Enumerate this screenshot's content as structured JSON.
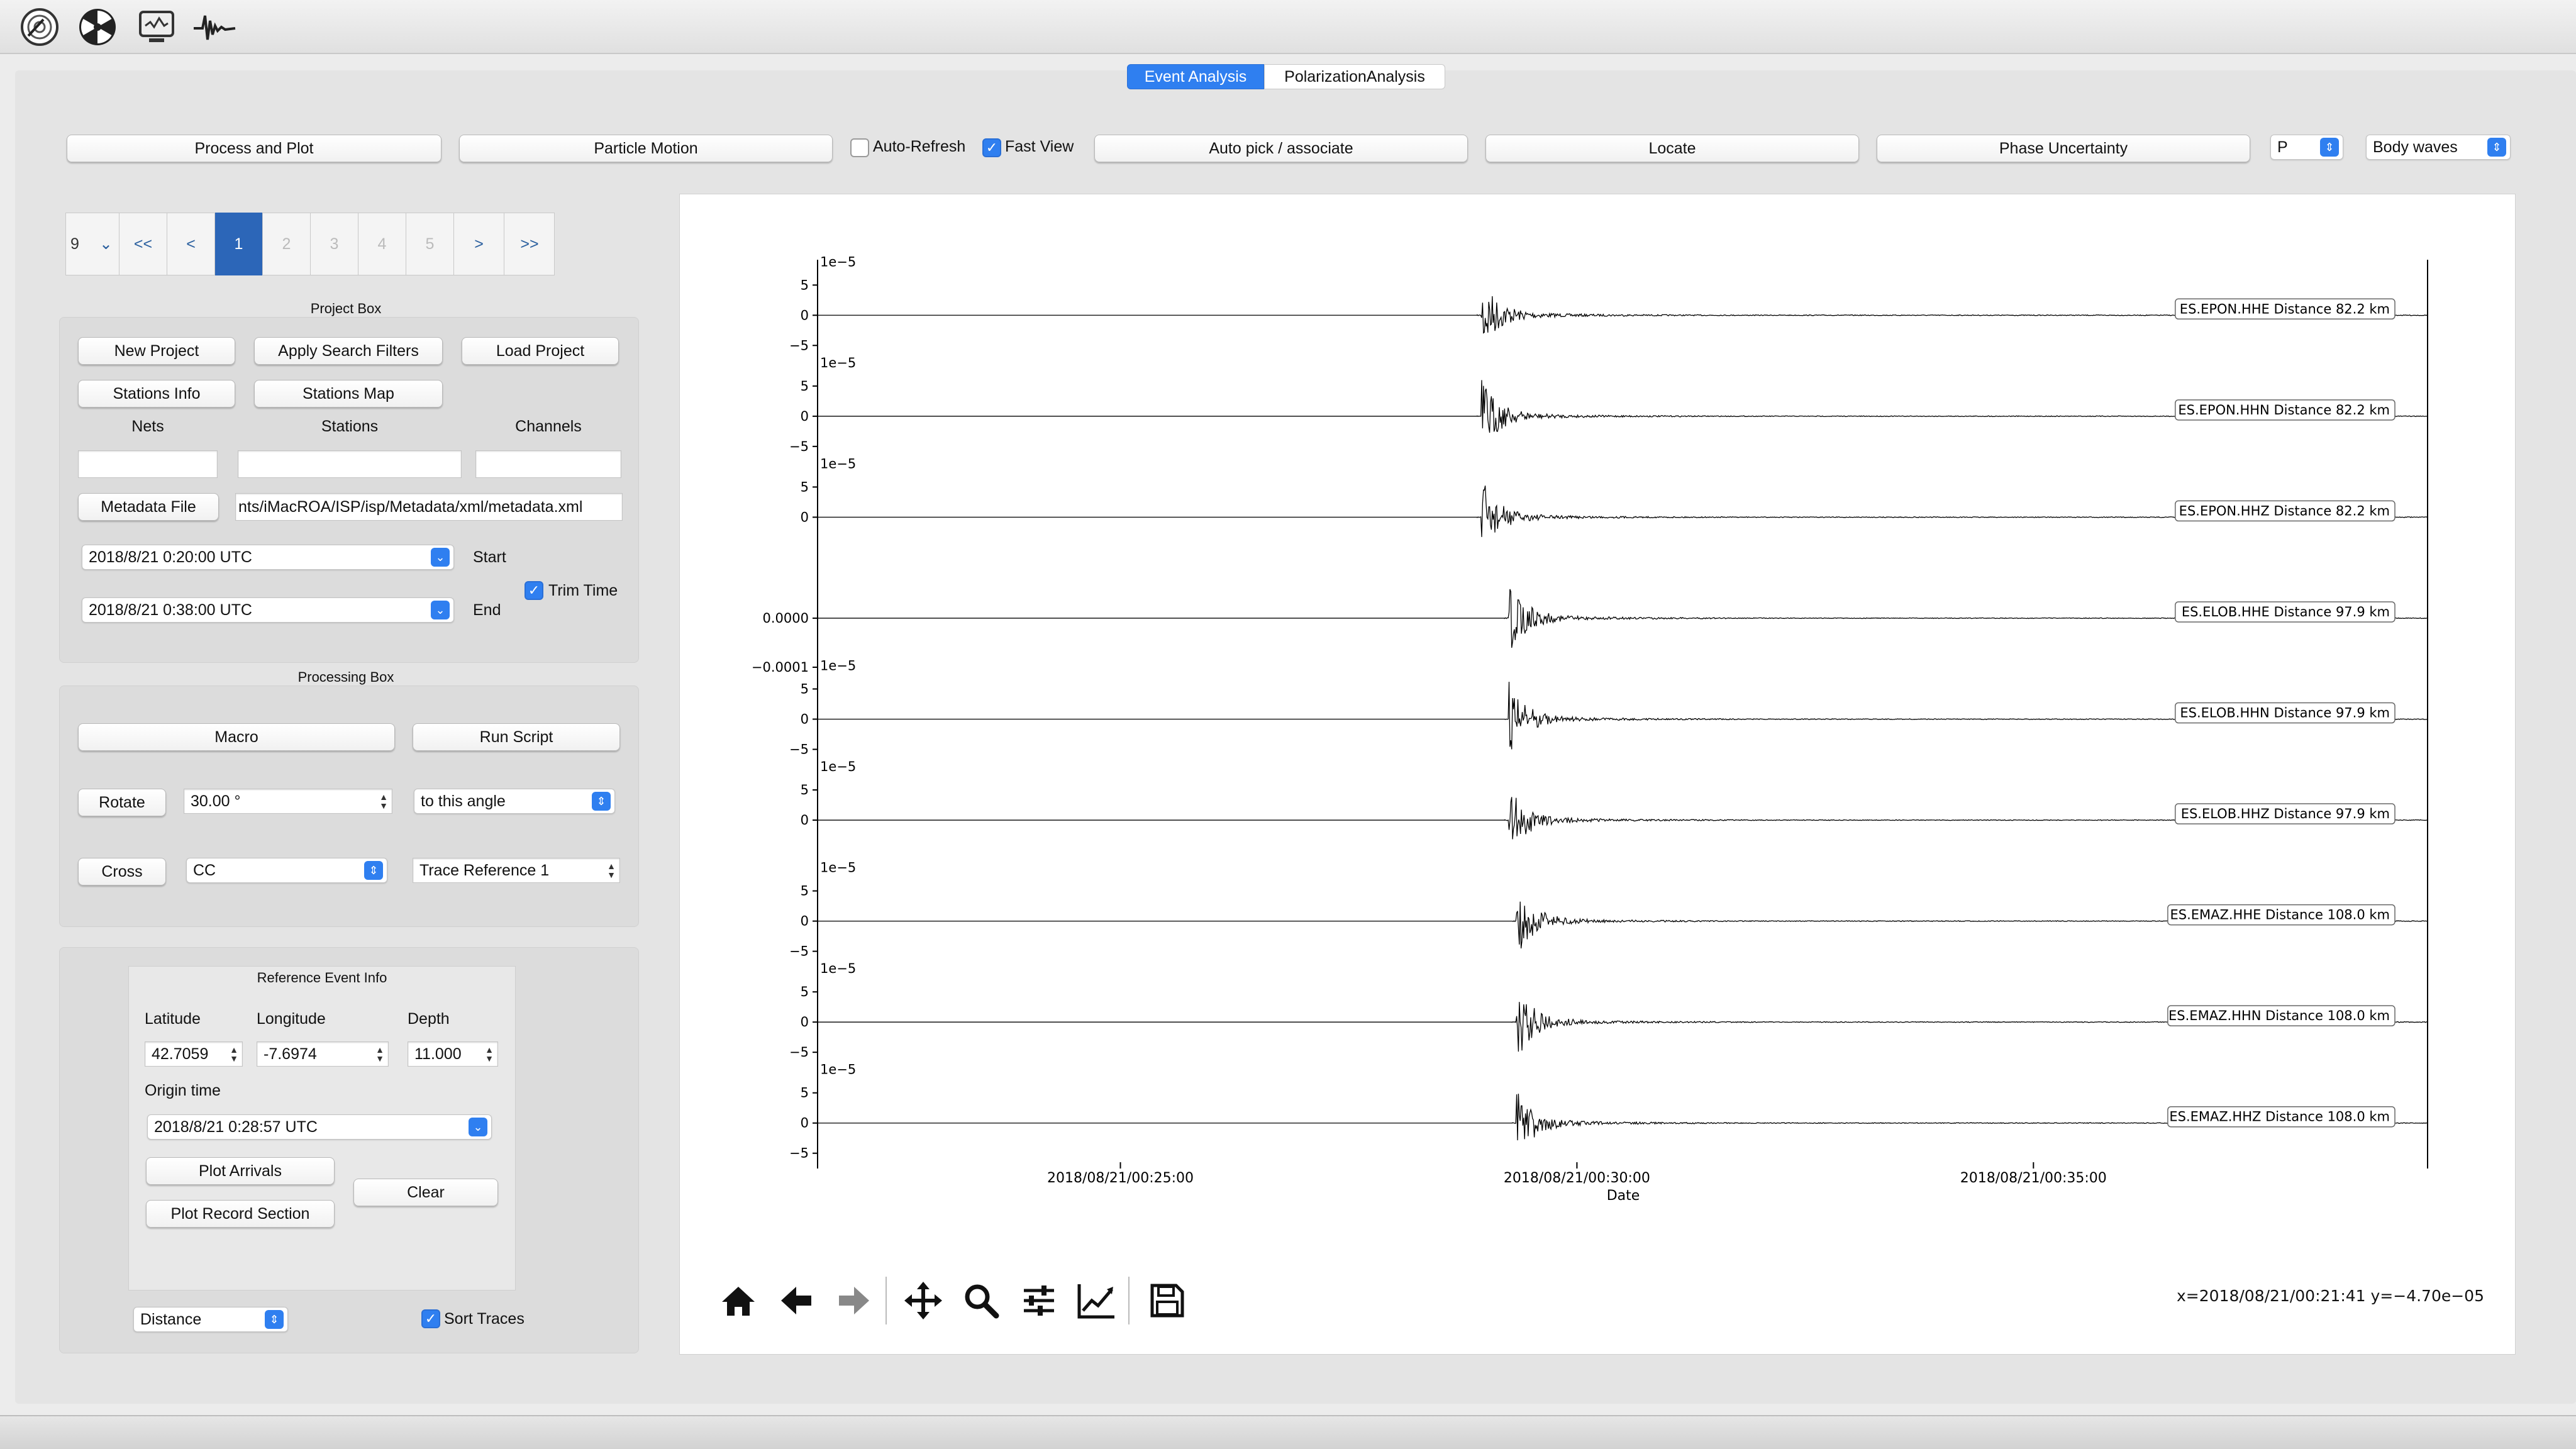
{
  "toolbar": {
    "icons": [
      "seismometer-icon",
      "radiation-icon",
      "monitor-icon",
      "waveform-icon"
    ]
  },
  "tabs": {
    "event_analysis": "Event Analysis",
    "polarization": "PolarizationAnalysis"
  },
  "actions": {
    "process_plot": "Process and Plot",
    "particle_motion": "Particle Motion",
    "auto_refresh": "Auto-Refresh",
    "fast_view": "Fast View",
    "auto_pick": "Auto pick / associate",
    "locate": "Locate",
    "phase_uncertainty": "Phase Uncertainty",
    "phase_select": "P",
    "wave_select": "Body waves"
  },
  "pager": {
    "selector": "9",
    "first": "<<",
    "prev": "<",
    "pages": [
      "1",
      "2",
      "3",
      "4",
      "5"
    ],
    "next": ">",
    "last": ">>"
  },
  "project_box": {
    "title": "Project Box",
    "new_project": "New Project",
    "apply_filters": "Apply Search Filters",
    "load_project": "Load Project",
    "stations_info": "Stations Info",
    "stations_map": "Stations Map",
    "nets_label": "Nets",
    "stations_label": "Stations",
    "channels_label": "Channels",
    "metadata_button": "Metadata File",
    "metadata_path": "nts/iMacROA/ISP/isp/Metadata/xml/metadata.xml",
    "start_date": "2018/8/21 0:20:00 UTC",
    "start_label": "Start",
    "end_date": "2018/8/21 0:38:00 UTC",
    "end_label": "End",
    "trim_time": "Trim Time"
  },
  "processing_box": {
    "title": "Processing Box",
    "macro": "Macro",
    "run_script": "Run Script",
    "rotate": "Rotate",
    "angle": "30.00 °",
    "angle_mode": "to this angle",
    "cross": "Cross",
    "cross_method": "CC",
    "trace_ref": "Trace Reference 1"
  },
  "ref_event": {
    "title": "Reference Event Info",
    "lat_label": "Latitude",
    "lon_label": "Longitude",
    "depth_label": "Depth",
    "lat": "42.7059",
    "lon": "-7.6974",
    "depth": "11.000",
    "origin_label": "Origin time",
    "origin": "2018/8/21 0:28:57 UTC",
    "plot_arrivals": "Plot Arrivals",
    "clear": "Clear",
    "plot_record": "Plot Record Section"
  },
  "sort": {
    "by": "Distance",
    "label": "Sort  Traces"
  },
  "plot": {
    "status": "x=2018/08/21/00:21:41 y=−4.70e−05",
    "toolbar_icons": [
      "home-icon",
      "back-arrow-icon",
      "forward-arrow-icon",
      "pan-icon",
      "zoom-icon",
      "configure-subplots-icon",
      "edit-axis-icon",
      "save-icon"
    ]
  },
  "chart_data": {
    "type": "line",
    "xlabel": "Date",
    "x_ticks": [
      "2018/08/21/00:25:00",
      "2018/08/21/00:30:00",
      "2018/08/21/00:35:00"
    ],
    "grid": false,
    "panels": [
      {
        "label": "ES.EPON.HHE Distance 82.2 km",
        "offset_label": "1e−5",
        "y_ticks": [
          "5",
          "0",
          "−5"
        ],
        "onset": "00:28:57"
      },
      {
        "label": "ES.EPON.HHN Distance 82.2 km",
        "offset_label": "1e−5",
        "y_ticks": [
          "5",
          "0",
          "−5"
        ],
        "onset": "00:28:57"
      },
      {
        "label": "ES.EPON.HHZ Distance 82.2 km",
        "offset_label": "1e−5",
        "y_ticks": [
          "5",
          "0"
        ],
        "onset": "00:28:57"
      },
      {
        "label": "ES.ELOB.HHE Distance 97.9 km",
        "offset_label": "",
        "y_ticks": [
          "0.0000",
          "−0.0001"
        ],
        "onset": "00:29:15"
      },
      {
        "label": "ES.ELOB.HHN Distance 97.9 km",
        "offset_label": "1e−5",
        "y_ticks": [
          "5",
          "0",
          "−5"
        ],
        "onset": "00:29:15"
      },
      {
        "label": "ES.ELOB.HHZ Distance 97.9 km",
        "offset_label": "1e−5",
        "y_ticks": [
          "5",
          "0"
        ],
        "onset": "00:29:15"
      },
      {
        "label": "ES.EMAZ.HHE Distance 108.0 km",
        "offset_label": "1e−5",
        "y_ticks": [
          "5",
          "0",
          "−5"
        ],
        "onset": "00:29:20"
      },
      {
        "label": "ES.EMAZ.HHN Distance 108.0 km",
        "offset_label": "1e−5",
        "y_ticks": [
          "5",
          "0",
          "−5"
        ],
        "onset": "00:29:20"
      },
      {
        "label": "ES.EMAZ.HHZ Distance 108.0 km",
        "offset_label": "1e−5",
        "y_ticks": [
          "5",
          "0",
          "−5"
        ],
        "onset": "00:29:20"
      }
    ]
  }
}
